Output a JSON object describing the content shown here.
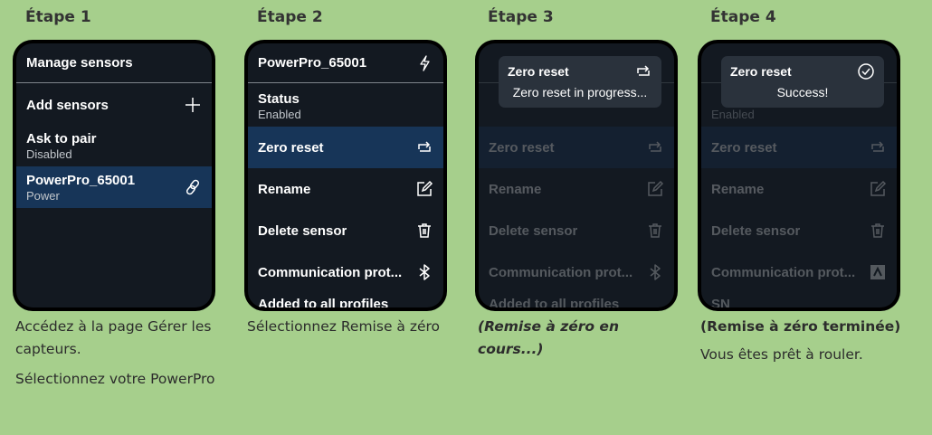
{
  "steps": [
    {
      "title": "Étape 1",
      "screen": {
        "header": "Manage sensors",
        "items": [
          {
            "label": "Add sensors",
            "icon": "plus-icon"
          },
          {
            "label": "Ask to pair",
            "sub": "Disabled"
          },
          {
            "label": "PowerPro_65001",
            "sub": "Power",
            "icon": "link-icon",
            "selected": true
          }
        ]
      },
      "caption": [
        "Accédez à la page Gérer les capteurs.",
        "Sélectionnez votre PowerPro"
      ]
    },
    {
      "title": "Étape 2",
      "screen": {
        "header": "PowerPro_65001",
        "header_icon": "power-bolt-icon",
        "items": [
          {
            "label": "Status",
            "sub": "Enabled"
          },
          {
            "label": "Zero reset",
            "icon": "reset-icon",
            "selected": true
          },
          {
            "label": "Rename",
            "icon": "edit-icon"
          },
          {
            "label": "Delete sensor",
            "icon": "trash-icon"
          },
          {
            "label": "Communication prot...",
            "icon": "bluetooth-icon"
          },
          {
            "label": "Added to all profiles"
          }
        ]
      },
      "caption": [
        "Sélectionnez Remise à zéro"
      ]
    },
    {
      "title": "Étape 3",
      "screen": {
        "background_rows": [
          "Zero reset",
          "Rename",
          "Delete sensor",
          "Communication prot...",
          "Added to all profiles"
        ],
        "toast": {
          "title": "Zero reset",
          "icon": "reset-icon",
          "message": "Zero reset in progress..."
        }
      },
      "caption": [
        "(Remise à zéro en cours...)"
      ]
    },
    {
      "title": "Étape 4",
      "screen": {
        "background_rows": [
          "Zero reset",
          "Rename",
          "Delete sensor",
          "Communication prot...",
          "SN"
        ],
        "background_sub": "Enabled",
        "toast": {
          "title": "Zero reset",
          "icon": "check-circle-icon",
          "message": "Success!"
        }
      },
      "caption": [
        "(Remise à zéro terminée)",
        "Vous êtes prêt à rouler."
      ]
    }
  ],
  "colors": {
    "background": "#a6cf8c",
    "screen": "#131921",
    "selected_row": "#173558",
    "toast": "#2a323c"
  }
}
